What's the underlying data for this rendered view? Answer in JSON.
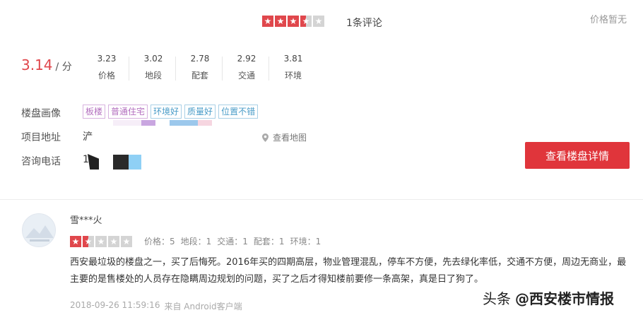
{
  "header": {
    "rating_stars": 3.5,
    "review_count": "1条评论",
    "price_status": "价格暂无"
  },
  "score": {
    "value": "3.14",
    "unit": "/ 分"
  },
  "sub_scores": [
    {
      "value": "3.23",
      "label": "价格"
    },
    {
      "value": "3.02",
      "label": "地段"
    },
    {
      "value": "2.78",
      "label": "配套"
    },
    {
      "value": "2.92",
      "label": "交通"
    },
    {
      "value": "3.81",
      "label": "环境"
    }
  ],
  "profile": {
    "label": "楼盘画像",
    "tags": [
      {
        "text": "板楼",
        "color": "#b36fbf"
      },
      {
        "text": "普通住宅",
        "color": "#b36fbf"
      },
      {
        "text": "环境好",
        "color": "#4a9cc8"
      },
      {
        "text": "质量好",
        "color": "#4a9cc8"
      },
      {
        "text": "位置不错",
        "color": "#4a9cc8"
      }
    ]
  },
  "address": {
    "label": "项目地址",
    "value": "浐",
    "map_link": "查看地图"
  },
  "phone": {
    "label": "咨询电话",
    "value": "1"
  },
  "detail_button": "查看楼盘详情",
  "review": {
    "user": "雪***火",
    "stars": 1.5,
    "scores": [
      "价格：5",
      "地段：1",
      "交通：1",
      "配套：1",
      "环境：1"
    ],
    "body": "西安最垃圾的楼盘之一，买了后悔死。2016年买的四期高层，物业管理混乱，停车不方便，先去绿化率低，交通不方便，周边无商业，最主要的是售楼处的人员存在隐瞒周边规划的问题，买了之后才得知楼前要修一条高架，真是日了狗了。",
    "timestamp": "2018-09-26 11:59:16",
    "source": "来自 Android客户端"
  },
  "watermark": {
    "prefix": "头条",
    "text": "@西安楼市情报"
  },
  "colors": {
    "accent": "#e0474c",
    "button": "#e0353b",
    "star_empty": "#d4d4d4"
  }
}
